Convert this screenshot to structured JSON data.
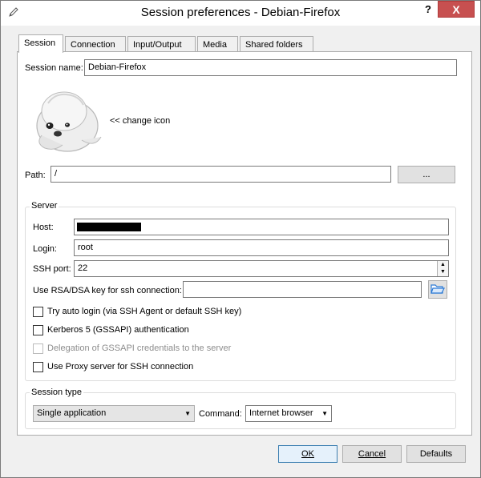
{
  "window": {
    "title": "Session preferences - Debian-Firefox",
    "help_label": "?",
    "close_label": "X"
  },
  "tabs": [
    {
      "label": "Session",
      "active": true
    },
    {
      "label": "Connection"
    },
    {
      "label": "Input/Output"
    },
    {
      "label": "Media"
    },
    {
      "label": "Shared folders"
    }
  ],
  "session": {
    "name_label": "Session name:",
    "name_value": "Debian-Firefox",
    "change_icon_label": "<< change icon",
    "path_label": "Path:",
    "path_value": "/",
    "browse_label": "..."
  },
  "server": {
    "title": "Server",
    "host_label": "Host:",
    "login_label": "Login:",
    "login_value": "root",
    "ssh_port_label": "SSH port:",
    "ssh_port_value": "22",
    "rsa_key_label": "Use RSA/DSA key for ssh connection:",
    "rsa_key_value": "",
    "options": [
      {
        "label": "Try auto login (via SSH Agent or default SSH key)",
        "checked": false,
        "enabled": true
      },
      {
        "label": "Kerberos 5 (GSSAPI) authentication",
        "checked": false,
        "enabled": true
      },
      {
        "label": "Delegation of GSSAPI credentials to the server",
        "checked": false,
        "enabled": false
      },
      {
        "label": "Use Proxy server for SSH connection",
        "checked": false,
        "enabled": true
      }
    ]
  },
  "session_type": {
    "title": "Session type",
    "type_value": "Single application",
    "command_label": "Command:",
    "command_value": "Internet browser"
  },
  "footer": {
    "ok_label": "OK",
    "cancel_label": "Cancel",
    "defaults_label": "Defaults"
  },
  "colors": {
    "close_button": "#c75050",
    "folder_icon": "#2d7bd6",
    "redacted_host": "#000000"
  }
}
